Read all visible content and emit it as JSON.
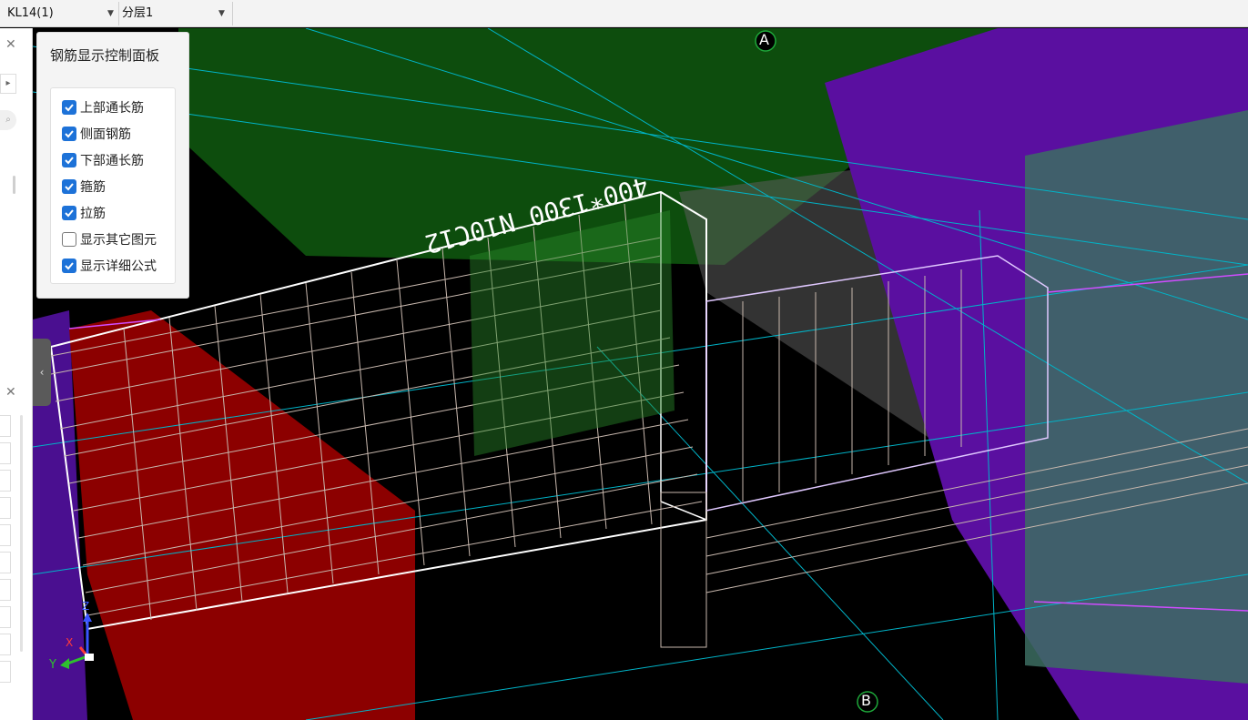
{
  "toolbar": {
    "element_select": {
      "value": "KL14(1)"
    },
    "layer_select": {
      "value": "分层1"
    }
  },
  "panel": {
    "title": "钢筋显示控制面板",
    "options": [
      {
        "label": "上部通长筋",
        "checked": true
      },
      {
        "label": "侧面钢筋",
        "checked": true
      },
      {
        "label": "下部通长筋",
        "checked": true
      },
      {
        "label": "箍筋",
        "checked": true
      },
      {
        "label": "拉筋",
        "checked": true
      },
      {
        "label": "显示其它图元",
        "checked": false
      },
      {
        "label": "显示详细公式",
        "checked": true
      }
    ]
  },
  "viewport": {
    "axis_labels": {
      "top": "A",
      "bottom": "B"
    },
    "beam_annotation": "400*1300 N10C12",
    "triad": {
      "x": "X",
      "y": "Y",
      "z": "Z"
    }
  },
  "colors": {
    "accent": "#1d72d8",
    "checkbox_checked": "#1d72d8",
    "viewport_bg": "#000000",
    "slab_green": "#0d4d0d",
    "column_purple": "#5a0fa0",
    "wall_red": "#8c0000",
    "rebar": "#c8b8ae",
    "grid_line": "#00b4c8"
  }
}
